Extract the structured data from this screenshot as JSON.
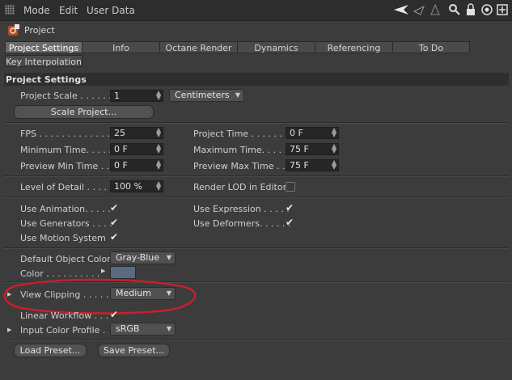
{
  "menubar": {
    "items": [
      "Mode",
      "Edit",
      "User Data"
    ],
    "icons": [
      "back-arrow-icon",
      "cursor-arrow-icon",
      "up-arrow-icon",
      "search-icon",
      "lock-icon",
      "target-icon",
      "new-window-icon"
    ]
  },
  "header": {
    "title": "Project"
  },
  "tabs": [
    {
      "label": "Project Settings",
      "active": true
    },
    {
      "label": "Info",
      "active": false
    },
    {
      "label": "Octane Render",
      "active": false
    },
    {
      "label": "Dynamics",
      "active": false
    },
    {
      "label": "Referencing",
      "active": false
    },
    {
      "label": "To Do",
      "active": false
    },
    {
      "label": "Key Interpolation",
      "active": false
    }
  ],
  "section": {
    "title": "Project Settings"
  },
  "project_scale": {
    "label": "Project Scale . . . . . .",
    "value": "1",
    "unit": "Centimeters"
  },
  "scale_project_button": "Scale Project...",
  "fps": {
    "label": "FPS . . . . . . . . . . . . .",
    "value": "25"
  },
  "project_time": {
    "label": "Project Time . . . . . . . .",
    "value": "0 F"
  },
  "min_time": {
    "label": "Minimum Time. . . . .",
    "value": "0 F"
  },
  "max_time": {
    "label": "Maximum Time. . . . .",
    "value": "75 F"
  },
  "preview_min": {
    "label": "Preview Min Time . .",
    "value": "0 F"
  },
  "preview_max": {
    "label": "Preview Max Time . .",
    "value": "75 F"
  },
  "lod": {
    "label": "Level of Detail . . . . .",
    "value": "100 %"
  },
  "render_lod": {
    "label": "Render LOD in Editor",
    "checked": false
  },
  "use_animation": {
    "label": "Use Animation. . . . .",
    "checked": true
  },
  "use_expression": {
    "label": "Use Expression . . . . .",
    "checked": true
  },
  "use_generators": {
    "label": "Use Generators . . . .",
    "checked": true
  },
  "use_deformers": {
    "label": "Use Deformers. . . . . .",
    "checked": true
  },
  "use_motion": {
    "label": "Use Motion System",
    "checked": true
  },
  "default_color": {
    "label": "Default Object Color",
    "value": "Gray-Blue"
  },
  "color": {
    "label": "Color . . . . . . . . . .",
    "swatch": "#5a6a80"
  },
  "view_clipping": {
    "label": "View Clipping . . . . .",
    "value": "Medium"
  },
  "linear_workflow": {
    "label": "Linear Workflow . . .",
    "checked": true
  },
  "input_color_profile": {
    "label": "Input Color Profile .",
    "value": "sRGB"
  },
  "load_preset_button": "Load Preset...",
  "save_preset_button": "Save Preset...",
  "colors": {
    "annotation": "#c8202a",
    "panel": "#3c3c3c",
    "field": "#262626"
  }
}
